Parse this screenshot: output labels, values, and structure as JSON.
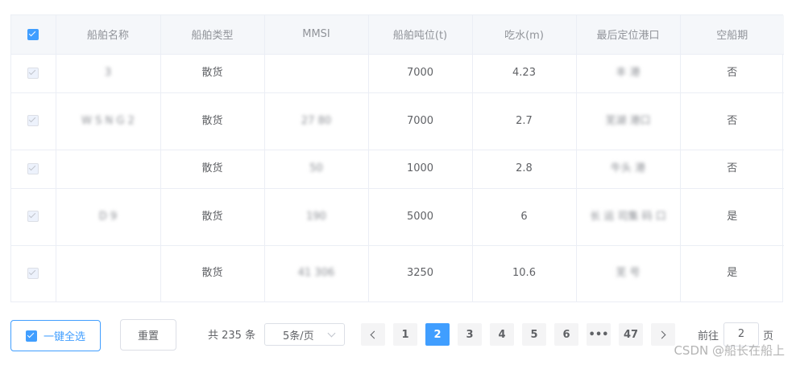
{
  "table": {
    "headers": [
      "船舶名称",
      "船舶类型",
      "MMSI",
      "船舶吨位(t)",
      "吃水(m)",
      "最后定位港口",
      "空船期"
    ],
    "rows": [
      {
        "name": "3",
        "type": "散货",
        "mmsi": "",
        "tonnage": "7000",
        "draft": "4.23",
        "port": "丰 港",
        "empty": "否"
      },
      {
        "name": "W S N G 2",
        "type": "散货",
        "mmsi": "27 80",
        "tonnage": "7000",
        "draft": "2.7",
        "port": "芜湖 港口",
        "empty": "否"
      },
      {
        "name": "",
        "type": "散货",
        "mmsi": "50",
        "tonnage": "1000",
        "draft": "2.8",
        "port": "牛头 港",
        "empty": "否"
      },
      {
        "name": "D 9",
        "type": "散货",
        "mmsi": "190",
        "tonnage": "5000",
        "draft": "6",
        "port": "长 运 司集 码 口",
        "empty": "是"
      },
      {
        "name": "",
        "type": "散货",
        "mmsi": "41 306",
        "tonnage": "3250",
        "draft": "10.6",
        "port": "芜 号",
        "empty": "是"
      }
    ]
  },
  "footer": {
    "select_all_label": "一键全选",
    "reset_label": "重置",
    "total_text": "共 235 条",
    "page_size": "5条/页",
    "pages": [
      "1",
      "2",
      "3",
      "4",
      "5",
      "6",
      "•••",
      "47"
    ],
    "current_page": "2",
    "goto_prefix": "前往",
    "goto_value": "2",
    "goto_suffix": "页"
  },
  "watermark": "CSDN @船长在船上",
  "colors": {
    "accent": "#409eff",
    "header_bg": "#f5f7fa",
    "border": "#ebeef5"
  }
}
